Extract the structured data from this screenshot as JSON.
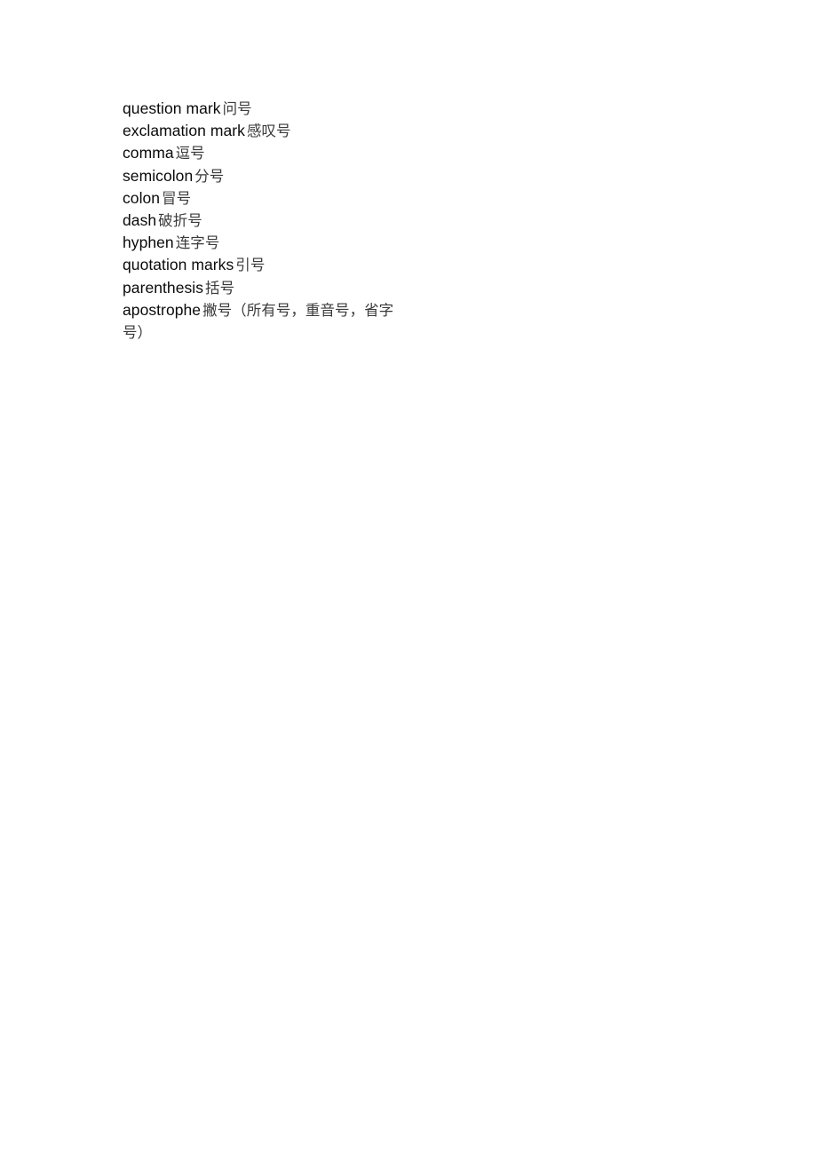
{
  "document": {
    "page_background": "#ffffff",
    "text_color": "#0a0a0a",
    "gloss_color": "#3a3a3a",
    "entries": [
      {
        "term": "question mark",
        "gloss": "问号"
      },
      {
        "term": "exclamation mark",
        "gloss": "感叹号"
      },
      {
        "term": "comma",
        "gloss": "逗号"
      },
      {
        "term": "semicolon",
        "gloss": "分号"
      },
      {
        "term": "colon",
        "gloss": "冒号"
      },
      {
        "term": "dash",
        "gloss": "破折号"
      },
      {
        "term": "hyphen",
        "gloss": "连字号"
      },
      {
        "term": "quotation marks",
        "gloss": "引号"
      },
      {
        "term": "parenthesis",
        "gloss": "括号"
      },
      {
        "term": "apostrophe",
        "gloss": "撇号（所有号，重音号，省字号）"
      }
    ]
  }
}
